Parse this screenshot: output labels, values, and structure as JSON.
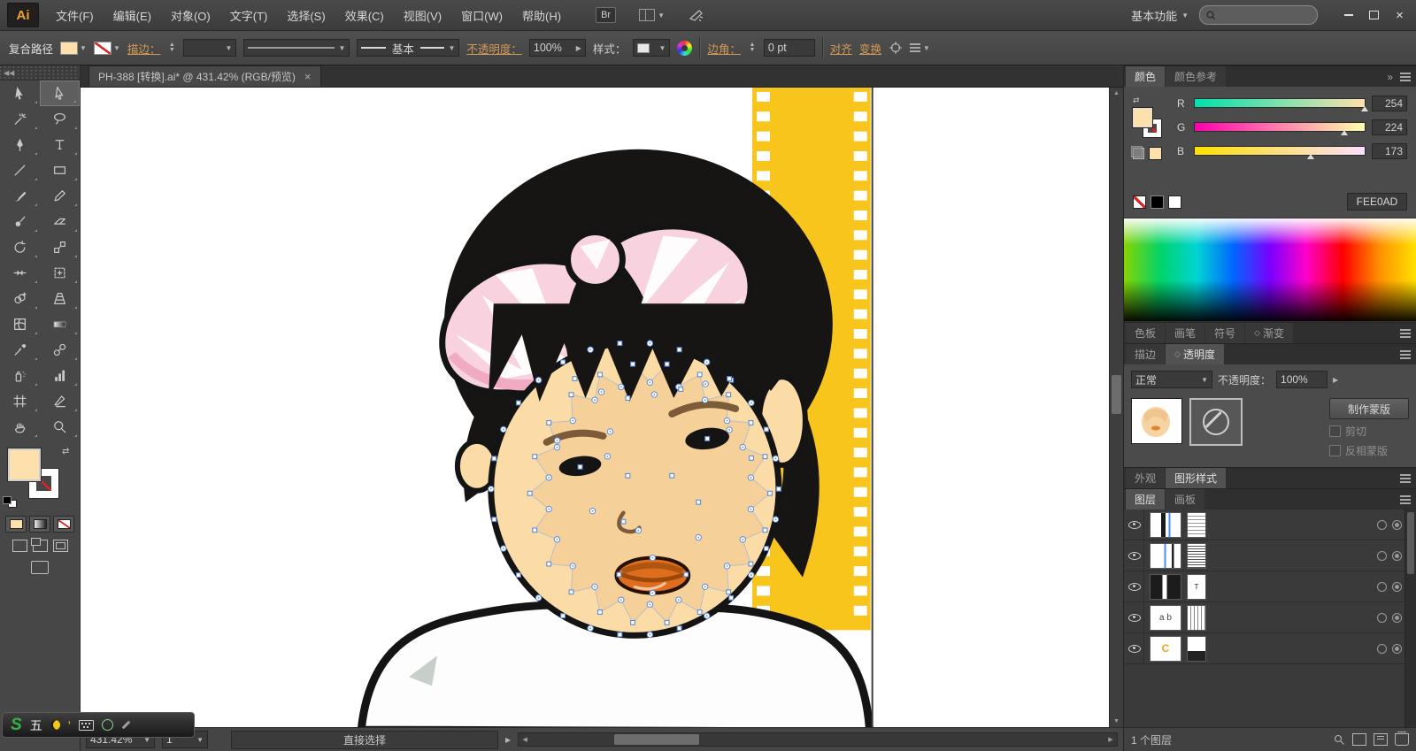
{
  "menu_bar": {
    "logo": "Ai",
    "items": [
      "文件(F)",
      "编辑(E)",
      "对象(O)",
      "文字(T)",
      "选择(S)",
      "效果(C)",
      "视图(V)",
      "窗口(W)",
      "帮助(H)"
    ],
    "bridge_label": "Br",
    "workspace_label": "基本功能",
    "search_placeholder": ""
  },
  "control_bar": {
    "object_label": "复合路径",
    "stroke_label": "描边：",
    "brush_value": "基本",
    "opacity_label": "不透明度：",
    "opacity_value": "100%",
    "style_label": "样式：",
    "corner_label": "边角：",
    "corner_value": "0 pt",
    "align_label": "对齐",
    "transform_label": "变换"
  },
  "document": {
    "tab_title": "PH-388 [转换].ai* @ 431.42% (RGB/预览)",
    "close_label": "×"
  },
  "toolbar": {
    "active": "direct-selection",
    "tools": [
      "selection",
      "direct-selection",
      "magic-wand",
      "lasso",
      "pen",
      "type",
      "line-segment",
      "rectangle",
      "paintbrush",
      "pencil",
      "blob-brush",
      "eraser",
      "rotate",
      "scale",
      "width",
      "free-transform",
      "shape-builder",
      "perspective-grid",
      "mesh",
      "gradient",
      "eyedropper",
      "blend",
      "symbol-sprayer",
      "column-graph",
      "artboard",
      "slice",
      "hand",
      "zoom"
    ]
  },
  "color_panel": {
    "tabs": [
      "颜色",
      "颜色参考"
    ],
    "active_tab": "颜色",
    "channels": [
      {
        "label": "R",
        "value": "254"
      },
      {
        "label": "G",
        "value": "224"
      },
      {
        "label": "B",
        "value": "173"
      }
    ],
    "hex_label": "#",
    "hex_value": "FEE0AD"
  },
  "panel_tabs": {
    "swatch_row": [
      "色板",
      "画笔",
      "符号",
      "渐变"
    ],
    "stroke_row": [
      "描边",
      "透明度"
    ],
    "appearance_row": [
      "外观",
      "图形样式"
    ],
    "layers_row": [
      "图层",
      "画板"
    ]
  },
  "transparency_panel": {
    "blend_mode": "正常",
    "opacity_label": "不透明度：",
    "opacity_value": "100%",
    "make_mask_label": "制作蒙版",
    "clip_label": "剪切",
    "invert_mask_label": "反相蒙版"
  },
  "layers_panel": {
    "footer_label": "1 个图层"
  },
  "status_bar": {
    "zoom_value": "431.42%",
    "artboard_value": "1",
    "tool_label": "直接选择"
  },
  "ime_bar": {
    "brand": "S",
    "mode_label": "五"
  },
  "canvas": {
    "colors": {
      "strip": "#F7C51B",
      "hair": "#171513",
      "skin": "#FBDCA6",
      "skin_shade": "#F3C68E",
      "bow": "#F8D3DF",
      "bow_shade": "#F0AAC2",
      "lips": "#DE6E1D",
      "lips_dark": "#9C4A0C",
      "brow": "#7C5B38",
      "body": "#FDFDFD",
      "accent": "#C6CFCA",
      "anchor": "#5B8BE0",
      "outline": "#141414"
    }
  }
}
